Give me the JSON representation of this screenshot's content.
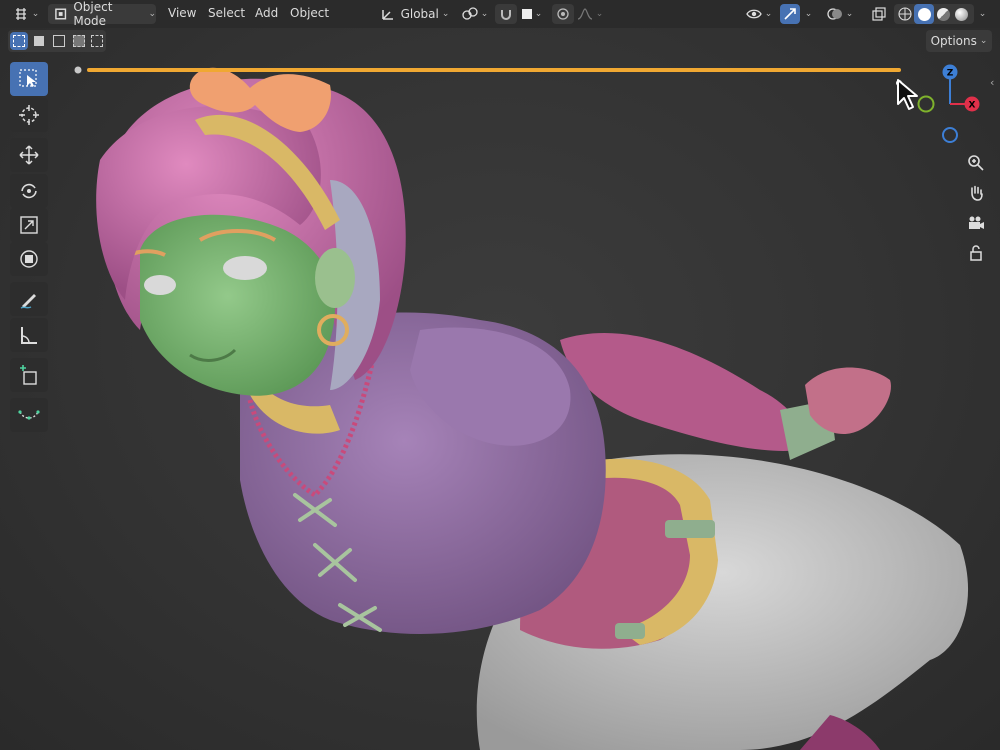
{
  "header": {
    "editor_type_icon": "viewport-icon",
    "mode_label": "Object Mode",
    "menus": [
      "View",
      "Select",
      "Add",
      "Object"
    ],
    "transform_orientation": "Global",
    "options_label": "Options"
  },
  "toolbar": {
    "tools": [
      "select-box-icon",
      "cursor-icon",
      "move-icon",
      "rotate-icon",
      "scale-icon",
      "transform-icon",
      "annotate-icon",
      "measure-icon",
      "add-cube-icon",
      "shear-icon"
    ]
  },
  "navigation": {
    "axes": [
      "Z",
      "X"
    ],
    "controls": [
      "zoom-icon",
      "hand-pan-icon",
      "camera-icon",
      "lock-icon"
    ]
  },
  "colors": {
    "accent": "#4772b3",
    "header_bg": "#2b2b2b",
    "annotation_line": "#f0a832",
    "axis_x": "#e0304a",
    "axis_y": "#7fb22c",
    "axis_z": "#3d7fd6"
  }
}
